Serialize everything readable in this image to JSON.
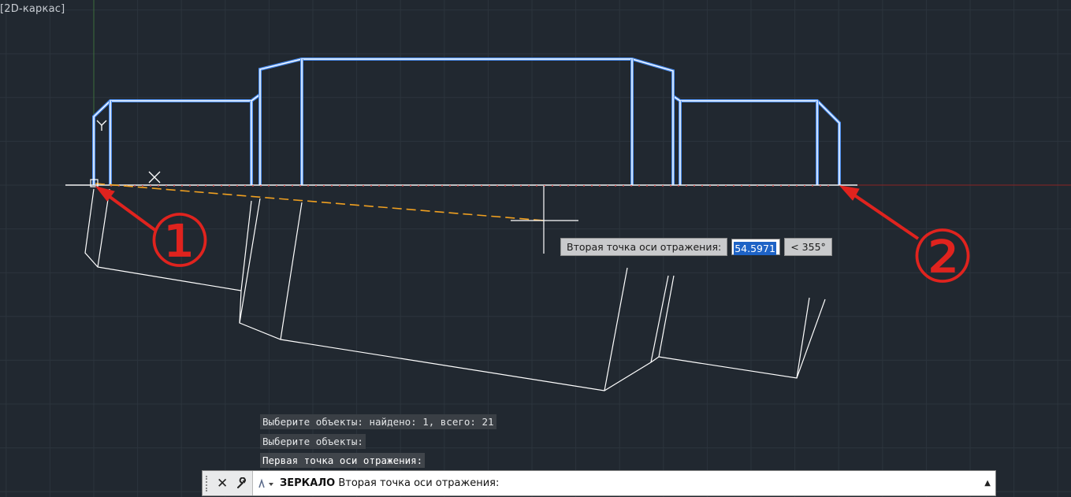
{
  "viewport": {
    "label": "[2D-каркас]"
  },
  "tooltip": {
    "prompt": "Вторая точка оси отражения:",
    "length_value": "54.5971",
    "angle_value": "< 355°"
  },
  "history": [
    "Выберите объекты: найдено: 1, всего: 21",
    "Выберите объекты:",
    "Первая точка оси отражения:"
  ],
  "command_line": {
    "command": "ЗЕРКАЛО",
    "prompt": "Вторая точка оси отражения:"
  },
  "annotations": {
    "marker_1": "①",
    "marker_2": "②"
  },
  "colors": {
    "background": "#212830",
    "grid": "#2c343d",
    "outline_blue": "#4d8ff0",
    "outline_white": "#ffffff",
    "axis_red": "#8a2424",
    "rubber_band": "#f0a020",
    "annotation_red": "#e0231e"
  },
  "icons": [
    "ucs-y-icon",
    "ucs-x-icon",
    "crosshair-cursor-icon",
    "close-icon",
    "wrench-icon",
    "command-prompt-icon",
    "scroll-up-icon"
  ]
}
